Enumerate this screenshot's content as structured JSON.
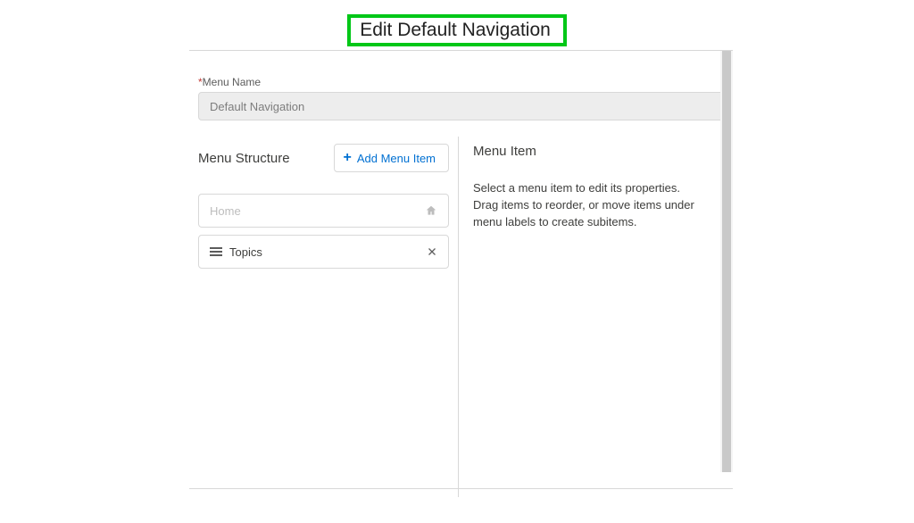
{
  "page": {
    "title": "Edit Default Navigation"
  },
  "menuName": {
    "label": "Menu Name",
    "value": "Default Navigation"
  },
  "left": {
    "sectionTitle": "Menu Structure",
    "addButton": "Add Menu Item",
    "items": [
      {
        "label": "Home",
        "type": "home"
      },
      {
        "label": "Topics",
        "type": "removable"
      }
    ]
  },
  "right": {
    "sectionTitle": "Menu Item",
    "description": "Select a menu item to edit its properties. Drag items to reorder, or move items under menu labels to create subitems."
  }
}
